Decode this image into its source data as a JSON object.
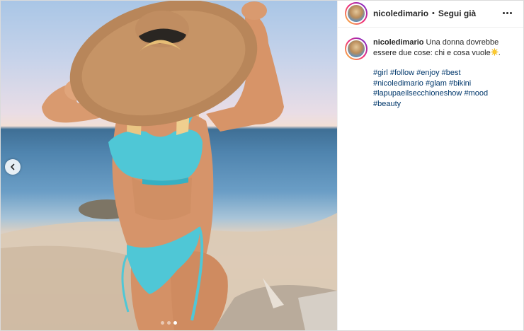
{
  "header": {
    "username": "nicoledimario",
    "separator": "•",
    "follow_label": "Segui già"
  },
  "caption": {
    "username": "nicoledimario",
    "text": "Una donna dovrebbe essere due cose: chi e cosa vuole",
    "end": ".",
    "hashtags": [
      "#girl",
      "#follow",
      "#enjoy",
      "#best",
      "#nicoledimario",
      "#glam",
      "#bikini",
      "#lapupaeilsecchioneshow",
      "#mood",
      "#beauty"
    ]
  },
  "carousel": {
    "total": 3,
    "active_index": 2
  },
  "icons": {
    "prev": "chevron-left-icon",
    "more": "more-horizontal-icon",
    "emoji": "sun-emoji-icon"
  },
  "colors": {
    "text": "#262626",
    "hashtag": "#00376b",
    "border": "#dbdbdb",
    "bikini": "#4fc7d6"
  }
}
